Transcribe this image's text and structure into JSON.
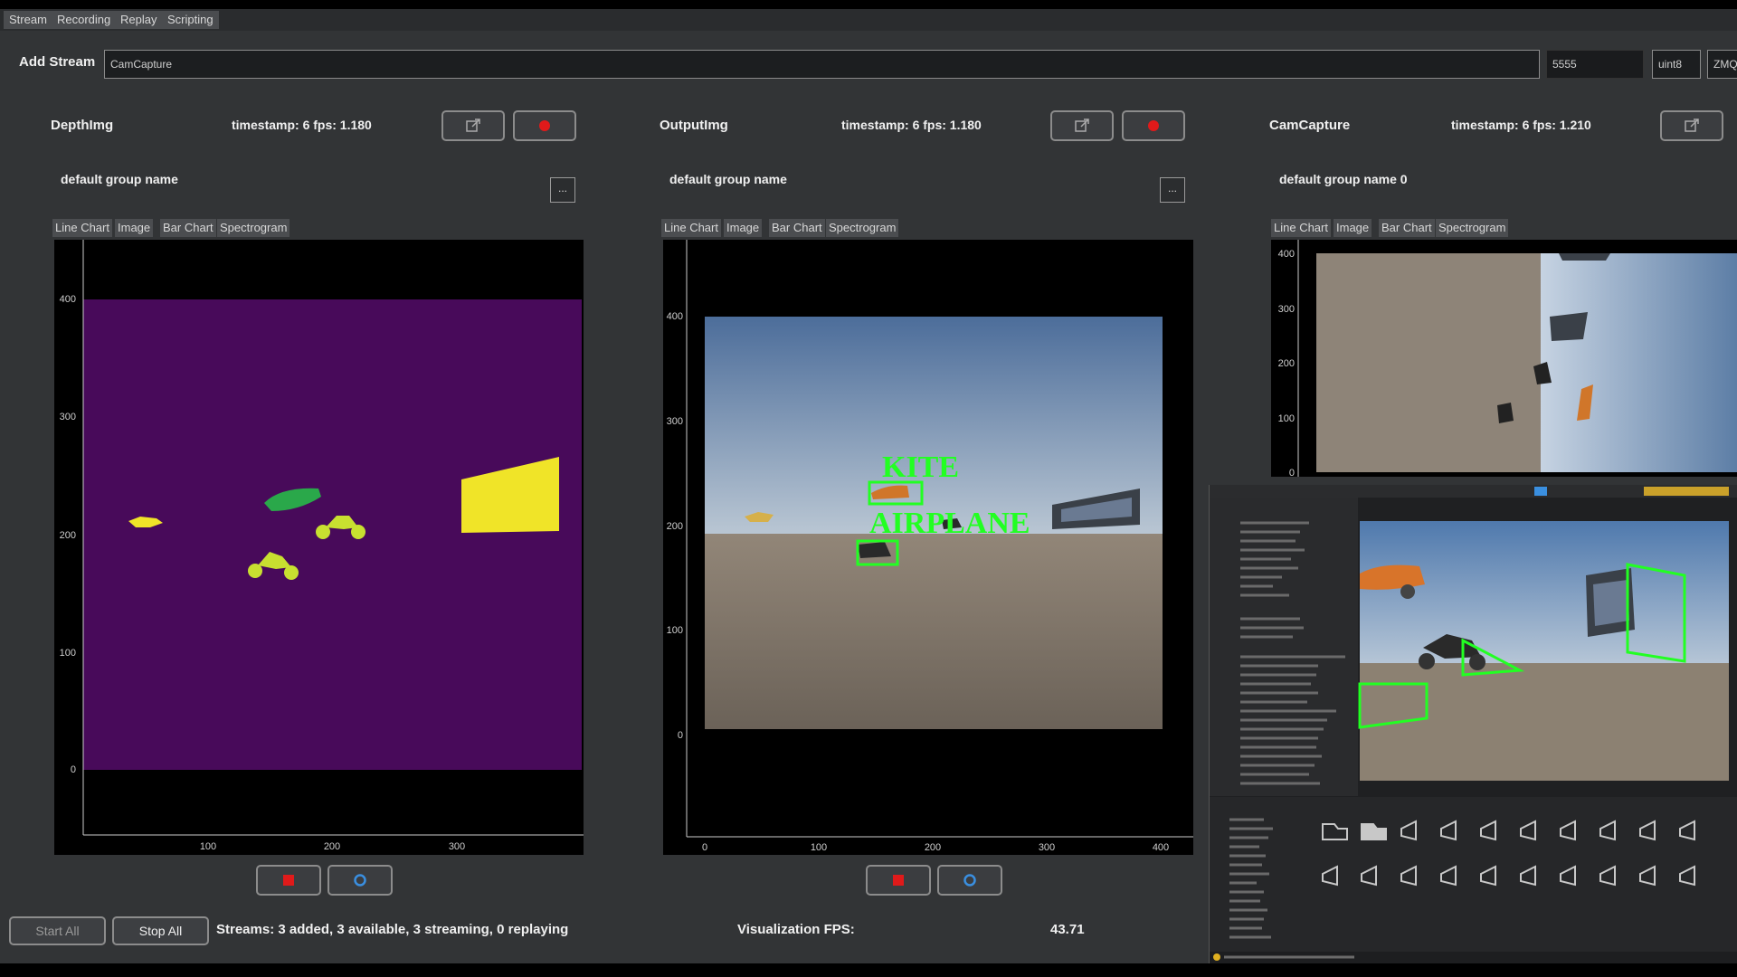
{
  "menu": [
    "Stream",
    "Recording",
    "Replay",
    "Scripting"
  ],
  "add_stream": {
    "label": "Add Stream",
    "name_value": "CamCapture",
    "port_value": "5555",
    "dtype_value": "uint8",
    "proto_value": "ZMQ"
  },
  "panels": [
    {
      "title": "DepthImg",
      "timestamp_text": "timestamp: 6 fps: 1.180",
      "group_name": "default group name",
      "group_btn": "...",
      "tabs": [
        "Line Chart",
        "Image",
        "Bar Chart",
        "Spectrogram"
      ],
      "x_ticks": [
        "100",
        "200",
        "300"
      ],
      "y_ticks": [
        "400",
        "300",
        "200",
        "100",
        "0"
      ]
    },
    {
      "title": "OutputImg",
      "timestamp_text": "timestamp: 6 fps: 1.180",
      "group_name": "default group name",
      "group_btn": "...",
      "tabs": [
        "Line Chart",
        "Image",
        "Bar Chart",
        "Spectrogram"
      ],
      "x_ticks": [
        "0",
        "100",
        "200",
        "300",
        "400"
      ],
      "y_ticks": [
        "400",
        "300",
        "200",
        "100",
        "0"
      ],
      "detections": [
        "KITE",
        "AIRPLANE"
      ]
    },
    {
      "title": "CamCapture",
      "timestamp_text": "timestamp: 6 fps: 1.210",
      "group_name": "default group name 0",
      "tabs": [
        "Line Chart",
        "Image",
        "Bar Chart",
        "Spectrogram"
      ],
      "y_ticks": [
        "400",
        "300",
        "200",
        "100",
        "0"
      ]
    }
  ],
  "bottom": {
    "start_all": "Start All",
    "stop_all": "Stop All",
    "streams_status": "Streams: 3 added, 3 available, 3 streaming, 0 replaying",
    "fps_label": "Visualization FPS:",
    "fps_value": "43.71"
  },
  "colors": {
    "background": "#323436",
    "record_red": "#e01a1a",
    "start_blue": "#3a8fe0",
    "detection_green": "#22ff22",
    "depth_purple": "#480a5a",
    "depth_yellow": "#f0e428"
  }
}
